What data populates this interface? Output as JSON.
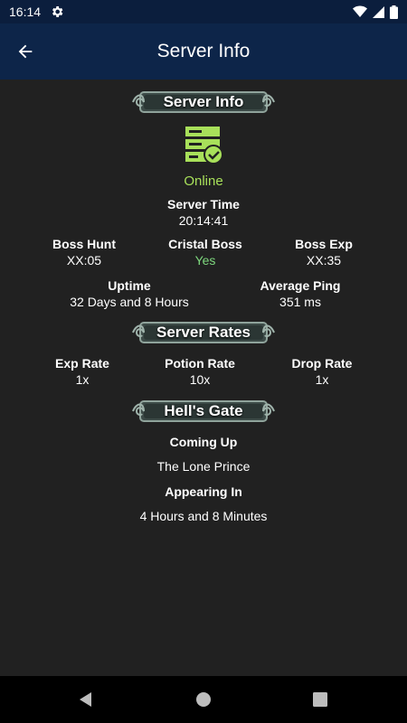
{
  "status_bar": {
    "time": "16:14"
  },
  "app_bar": {
    "title": "Server Info"
  },
  "server_info": {
    "banner": "Server Info",
    "status": "Online",
    "server_time_label": "Server Time",
    "server_time_value": "20:14:41",
    "boss_hunt_label": "Boss Hunt",
    "boss_hunt_value": "XX:05",
    "cristal_boss_label": "Cristal Boss",
    "cristal_boss_value": "Yes",
    "boss_exp_label": "Boss Exp",
    "boss_exp_value": "XX:35",
    "uptime_label": "Uptime",
    "uptime_value": "32 Days and 8 Hours",
    "avg_ping_label": "Average Ping",
    "avg_ping_value": "351 ms"
  },
  "server_rates": {
    "banner": "Server Rates",
    "exp_rate_label": "Exp Rate",
    "exp_rate_value": "1x",
    "potion_rate_label": "Potion Rate",
    "potion_rate_value": "10x",
    "drop_rate_label": "Drop Rate",
    "drop_rate_value": "1x"
  },
  "hells_gate": {
    "banner": "Hell's Gate",
    "coming_up_label": "Coming Up",
    "coming_up_value": "The Lone Prince",
    "appearing_in_label": "Appearing In",
    "appearing_in_value": "4 Hours and 8 Minutes"
  },
  "colors": {
    "status_bar": "#0b1e3d",
    "app_bar": "#0d2549",
    "background": "#212121",
    "online_green": "#a8e05a",
    "yes_green": "#7ed87e"
  }
}
